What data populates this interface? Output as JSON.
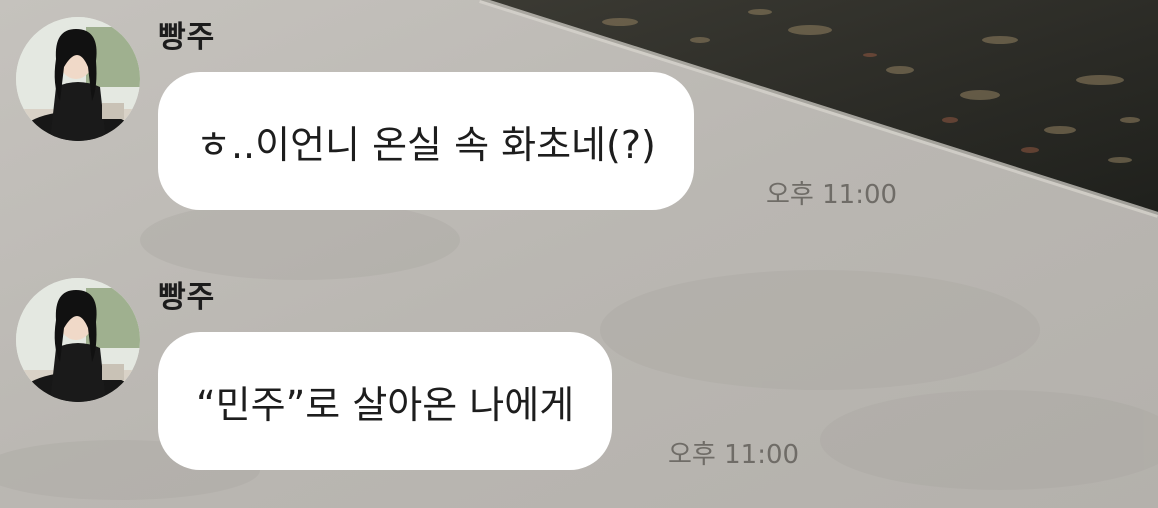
{
  "chat": {
    "messages": [
      {
        "sender": "빵주",
        "text": "ㅎ..이언니 온실 속 화초네(?)",
        "time": "오후 11:00",
        "avatar_icon": "profile-photo"
      },
      {
        "sender": "빵주",
        "text": "“민주”로 살아온 나에게",
        "time": "오후 11:00",
        "avatar_icon": "profile-photo"
      }
    ]
  },
  "colors": {
    "bubble": "#ffffff",
    "background": "#b9b6b1",
    "timestamp": "#6f6c67"
  }
}
